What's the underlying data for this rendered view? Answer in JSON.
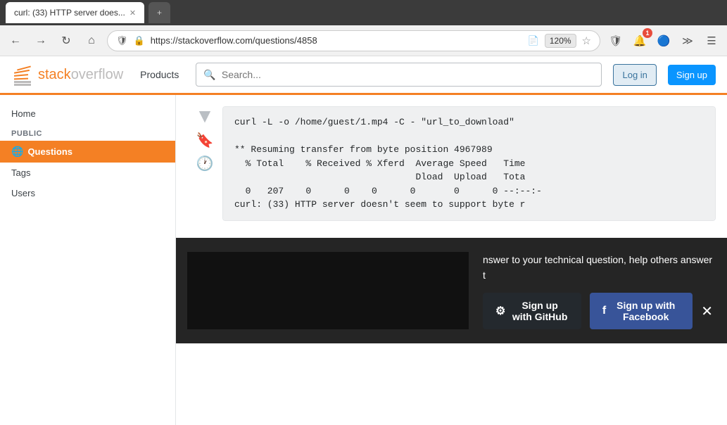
{
  "browser": {
    "tab_active_label": "curl: (33) HTTP server does...",
    "tab_inactive_label": "",
    "url": "https://stackoverflow.com/questions/4858",
    "zoom": "120%"
  },
  "so_header": {
    "logo_text_stack": "stack",
    "logo_text_overflow": "overflow",
    "nav_products": "Products",
    "search_placeholder": "Search...",
    "btn_login": "Log in",
    "btn_signup": "Sign up"
  },
  "sidebar": {
    "home_label": "Home",
    "public_section": "PUBLIC",
    "questions_label": "Questions",
    "tags_label": "Tags",
    "users_label": "Users"
  },
  "code_block": {
    "line1": "curl -L -o /home/guest/1.mp4 -C - \"url_to_download\"",
    "line2": "",
    "line3": "** Resuming transfer from byte position 4967989",
    "line4": "  % Total    % Received % Xferd  Average Speed   Time",
    "line5": "                                 Dload  Upload   Tota",
    "line6": "  0   207    0      0    0      0       0      0 --:--:-",
    "line7": "curl: (33) HTTP server doesn't seem to support byte r"
  },
  "overlay": {
    "text_line1": "nswer to your technical question, help others answer",
    "text_line2": "t",
    "btn_github": "Sign up with GitHub",
    "btn_facebook": "Sign up with Facebook"
  }
}
